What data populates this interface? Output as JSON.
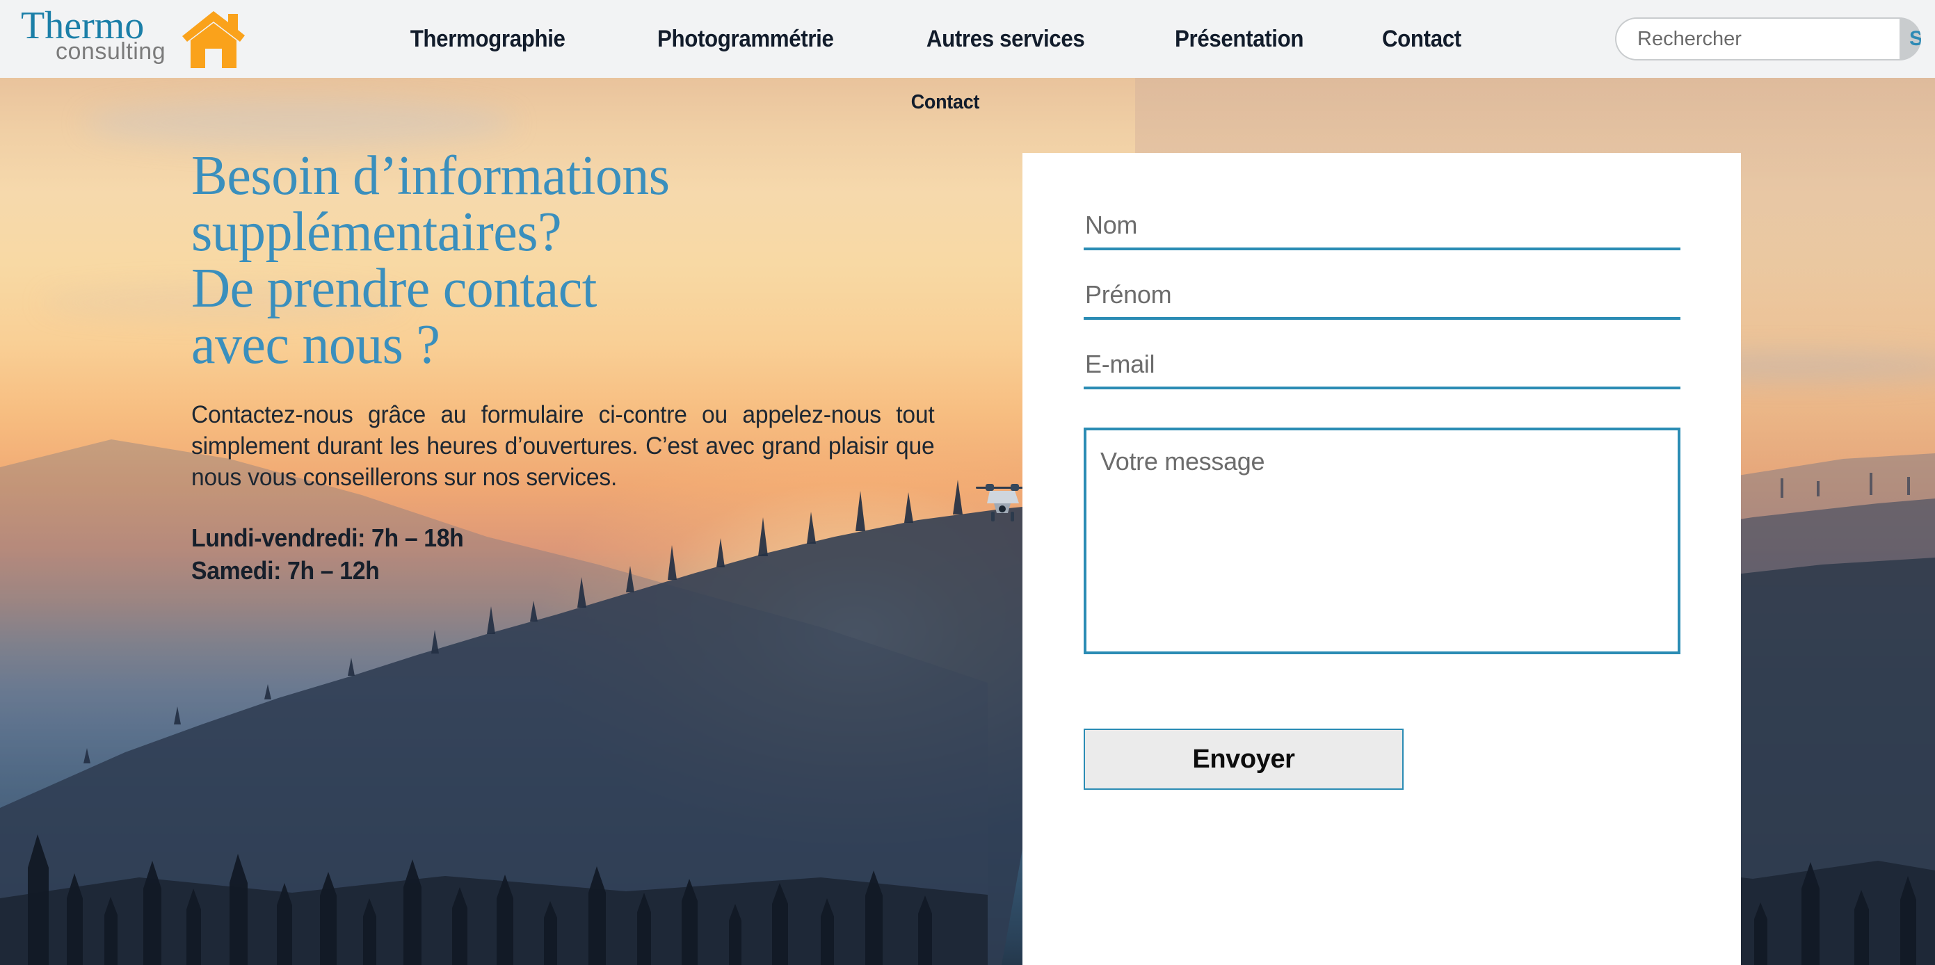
{
  "header": {
    "logo": {
      "primary": "Thermo",
      "secondary": "consulting",
      "icon": "house-icon"
    },
    "nav": [
      {
        "label": "Thermographie"
      },
      {
        "label": "Photogrammétrie"
      },
      {
        "label": "Autres services"
      },
      {
        "label": "Présentation"
      },
      {
        "label": "Contact"
      }
    ],
    "search": {
      "placeholder": "Rechercher",
      "value": "",
      "button_label": "Search",
      "icon": "search-icon"
    }
  },
  "hero": {
    "breadcrumb": "Contact",
    "title_lines": [
      "Besoin d’informations",
      "supplémentaires?",
      "De prendre contact",
      "avec nous ?"
    ],
    "paragraph": "Contactez-nous grâce au formulaire ci-contre ou appelez-nous tout simplement durant les heures d’ouvertures. C’est avec grand plaisir que nous vous conseillerons sur nos services.",
    "hours": [
      "Lundi-vendredi: 7h – 18h",
      "Samedi: 7h – 12h"
    ],
    "background_alt": "sunset-mountain-drone-photo"
  },
  "contact_form": {
    "fields": [
      {
        "name": "nom",
        "placeholder": "Nom",
        "value": ""
      },
      {
        "name": "prenom",
        "placeholder": "Prénom",
        "value": ""
      },
      {
        "name": "email",
        "placeholder": "E-mail",
        "value": ""
      }
    ],
    "message": {
      "placeholder": "Votre message",
      "value": ""
    },
    "submit_label": "Envoyer"
  },
  "colors": {
    "accent_blue": "#2b8cb4",
    "heading_blue": "#3a8fbd",
    "logo_blue": "#1b7fa8",
    "logo_orange": "#faa21b",
    "nav_dark": "#121c2b",
    "header_bg": "#f2f3f4",
    "search_bar_bg": "#c9ccce",
    "button_bg": "#ebebeb"
  }
}
